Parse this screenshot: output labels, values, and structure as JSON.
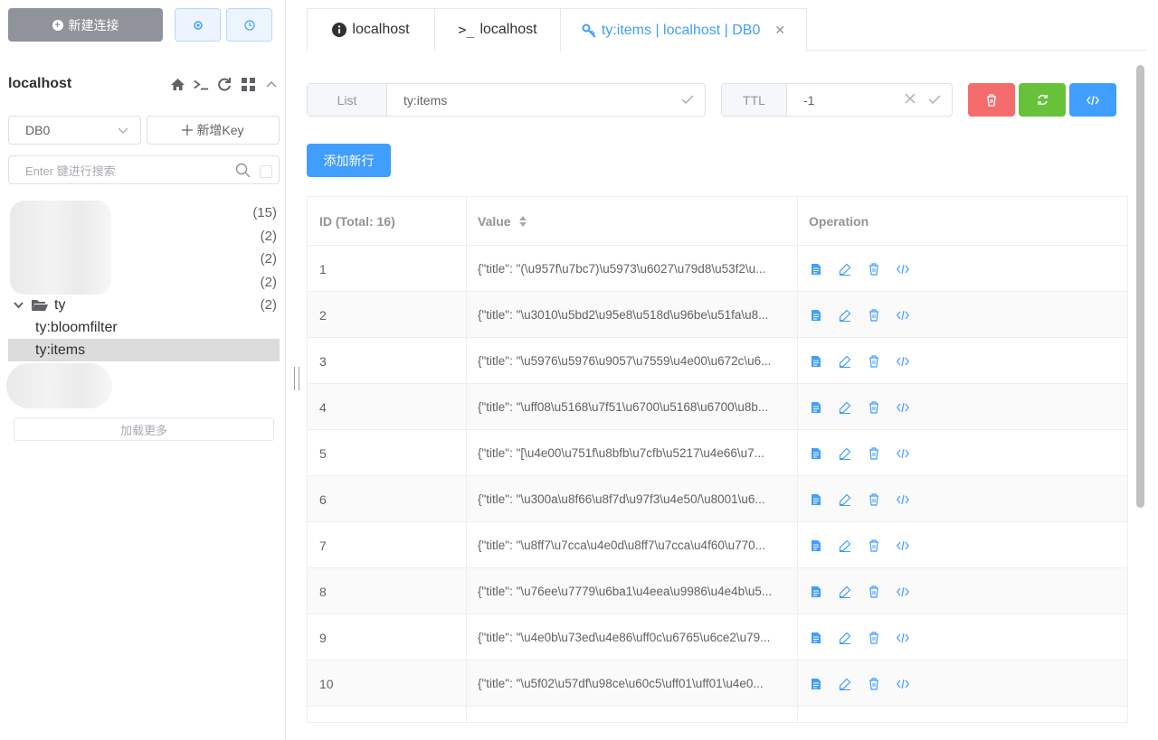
{
  "sidebar": {
    "new_connection_label": "新建连接",
    "connection_name": "localhost",
    "db_selected": "DB0",
    "new_key_label": "新增Key",
    "search_placeholder": "Enter 键进行搜索",
    "tree_counts": [
      "(15)",
      "(2)",
      "(2)",
      "(2)"
    ],
    "folder": {
      "name": "ty",
      "count": "(2)"
    },
    "keys": [
      {
        "label": "ty:bloomfilter",
        "selected": false
      },
      {
        "label": "ty:items",
        "selected": true
      }
    ],
    "load_more_label": "加载更多"
  },
  "tabs": [
    {
      "icon": "info-icon",
      "label": "localhost"
    },
    {
      "icon": "terminal-icon",
      "label": "localhost"
    },
    {
      "icon": "key-icon",
      "label": "ty:items | localhost | DB0",
      "active": true
    }
  ],
  "key_panel": {
    "type_label": "List",
    "key_name": "ty:items",
    "ttl_label": "TTL",
    "ttl_value": "-1",
    "add_row_label": "添加新行"
  },
  "colors": {
    "primary": "#409eff",
    "danger": "#f56c6c",
    "success": "#67c23a",
    "gray": "#909399"
  },
  "table": {
    "headers": {
      "id": "ID (Total: 16)",
      "value": "Value",
      "operation": "Operation"
    },
    "rows": [
      {
        "id": "1",
        "value": "{\"title\": \"(\\u957f\\u7bc7)\\u5973\\u6027\\u79d8\\u53f2\\u..."
      },
      {
        "id": "2",
        "value": "{\"title\": \"\\u3010\\u5bd2\\u95e8\\u518d\\u96be\\u51fa\\u8..."
      },
      {
        "id": "3",
        "value": "{\"title\": \"\\u5976\\u5976\\u9057\\u7559\\u4e00\\u672c\\u6..."
      },
      {
        "id": "4",
        "value": "{\"title\": \"\\uff08\\u5168\\u7f51\\u6700\\u5168\\u6700\\u8b..."
      },
      {
        "id": "5",
        "value": "{\"title\": \"[\\u4e00\\u751f\\u8bfb\\u7cfb\\u5217\\u4e66\\u7..."
      },
      {
        "id": "6",
        "value": "{\"title\": \"\\u300a\\u8f66\\u8f7d\\u97f3\\u4e50/\\u8001\\u6..."
      },
      {
        "id": "7",
        "value": "{\"title\": \"\\u8ff7\\u7cca\\u4e0d\\u8ff7\\u7cca\\u4f60\\u770..."
      },
      {
        "id": "8",
        "value": "{\"title\": \"\\u76ee\\u7779\\u6ba1\\u4eea\\u9986\\u4e4b\\u5..."
      },
      {
        "id": "9",
        "value": "{\"title\": \"\\u4e0b\\u73ed\\u4e86\\uff0c\\u6765\\u6ce2\\u79..."
      },
      {
        "id": "10",
        "value": "{\"title\": \"\\u5f02\\u57df\\u98ce\\u60c5\\uff01\\uff01\\u4e0..."
      }
    ]
  }
}
